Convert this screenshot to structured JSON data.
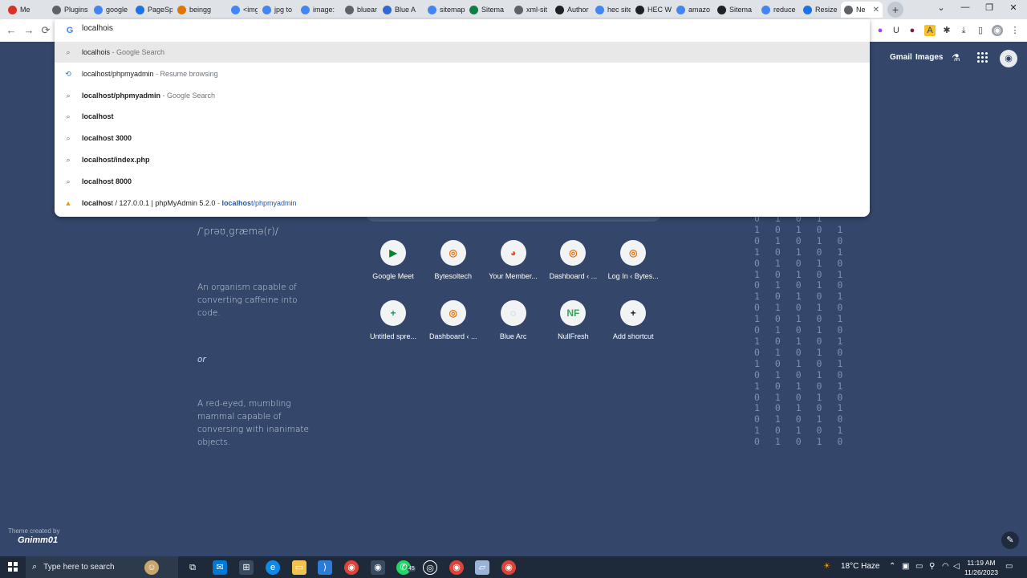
{
  "browser": {
    "tabs": [
      {
        "title": "Me",
        "color": "#d93025"
      },
      {
        "title": "Plugins",
        "color": "#5f6368"
      },
      {
        "title": "google",
        "color": "#4285f4"
      },
      {
        "title": "PageSp",
        "color": "#1a73e8"
      },
      {
        "title": "beingg",
        "color": "#e37400"
      },
      {
        "title": "<img s",
        "color": "#4285f4"
      },
      {
        "title": "jpg to",
        "color": "#4285f4"
      },
      {
        "title": "image:",
        "color": "#4285f4"
      },
      {
        "title": "bluear",
        "color": "#5f6368"
      },
      {
        "title": "Blue A",
        "color": "#3367d6"
      },
      {
        "title": "sitemap",
        "color": "#4285f4"
      },
      {
        "title": "Sitema",
        "color": "#0b8043"
      },
      {
        "title": "xml-sit",
        "color": "#5f6368"
      },
      {
        "title": "Author",
        "color": "#202124"
      },
      {
        "title": "hec site",
        "color": "#4285f4"
      },
      {
        "title": "HEC W",
        "color": "#202124"
      },
      {
        "title": "amazo",
        "color": "#4285f4"
      },
      {
        "title": "Sitema",
        "color": "#202124"
      },
      {
        "title": "reduce",
        "color": "#4285f4"
      },
      {
        "title": "Resize",
        "color": "#1a73e8"
      },
      {
        "title": "Ne",
        "color": "#5f6368",
        "active": true
      }
    ],
    "new_tab_symbol": "+",
    "window_controls": {
      "dropdown": "⌄",
      "minimize": "—",
      "maximize": "❐",
      "close": "✕"
    },
    "toolbar": {
      "back": "←",
      "forward": "→",
      "reload": "⟳"
    }
  },
  "omnibox": {
    "input_value": "localhois",
    "suggestions": [
      {
        "main": "localhois",
        "suffix": " - Google Search",
        "type": "search",
        "selected": true
      },
      {
        "main": "localhost/phpmyadmin",
        "suffix": " - Resume browsing",
        "type": "history"
      },
      {
        "main": "localhost/phpmyadmin",
        "suffix": " - Google Search",
        "type": "search",
        "bold": true
      },
      {
        "main": "localhost",
        "suffix": "",
        "type": "search",
        "bold": true
      },
      {
        "main": "localhost 3000",
        "suffix": "",
        "type": "search",
        "bold": true
      },
      {
        "main": "localhost/index.php",
        "suffix": "",
        "type": "search",
        "bold": true
      },
      {
        "main": "localhost 8000",
        "suffix": "",
        "type": "search",
        "bold": true
      },
      {
        "main_bold": "localhos",
        "main_rest": "t / 127.0.0.1 | phpMyAdmin 5.2.0",
        "sep": " - ",
        "url_bold": "localhos",
        "url_rest": "t/phpmyadmin",
        "type": "site"
      }
    ]
  },
  "google_header": {
    "gmail": "Gmail",
    "images": "Images"
  },
  "theme": {
    "pronunciation": "/ˈprəʊˌɡræmə(r)/",
    "definition1": "An organism capable of converting caffeine into code.",
    "or": "or",
    "definition2": "A red-eyed, mumbling mammal capable of conversing with inanimate objects.",
    "binary": "0 1 0 1\n1 0 1 0 1\n0 1 0 1 0\n1 0 1 0 1\n0 1 0 1 0\n1 0 1 0 1\n0 1 0 1 0\n1 0 1 0 1\n0 1 0 1 0\n1 0 1 0 1\n0 1 0 1 0\n1 0 1 0 1\n0 1 0 1 0\n1 0 1 0 1\n0 1 0 1 0\n1 0 1 0 1\n0 1 0 1 0\n1 0 1 0 1\n0 1 0 1 0\n1 0 1 0 1\n0 1 0 1 0",
    "credit": "Theme created by",
    "author": "Gnimm01"
  },
  "shortcuts": [
    {
      "label": "Google Meet",
      "glyph": "▶",
      "color": "#00832d"
    },
    {
      "label": "Bytesoltech",
      "glyph": "◎",
      "color": "#e8710a"
    },
    {
      "label": "Your Member...",
      "glyph": "◕",
      "color": "#ff4500"
    },
    {
      "label": "Dashboard ‹ ...",
      "glyph": "◎",
      "color": "#e8710a"
    },
    {
      "label": "Log In ‹ Bytes...",
      "glyph": "◎",
      "color": "#e8710a"
    },
    {
      "label": "Untitled spre...",
      "glyph": "+",
      "color": "#0f9d58"
    },
    {
      "label": "Dashboard ‹ ...",
      "glyph": "◎",
      "color": "#e8710a"
    },
    {
      "label": "Blue Arc",
      "glyph": "◌",
      "color": "#9aa0a6"
    },
    {
      "label": "NullFresh",
      "glyph": "NF",
      "color": "#34a853"
    },
    {
      "label": "Add shortcut",
      "glyph": "+",
      "color": "#202124"
    }
  ],
  "taskbar": {
    "search_placeholder": "Type here to search",
    "weather": "18°C  Haze",
    "time": "11:19 AM",
    "date": "11/26/2023",
    "whatsapp_badge": "45"
  }
}
